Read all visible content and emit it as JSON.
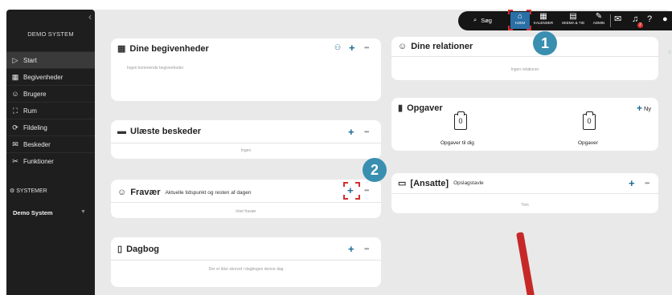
{
  "sidebar": {
    "title": "DEMO SYSTEM",
    "items": [
      {
        "label": "Start",
        "icon": "play-icon",
        "glyph": "▷"
      },
      {
        "label": "Begivenheder",
        "icon": "calendar-icon",
        "glyph": "▦"
      },
      {
        "label": "Brugere",
        "icon": "users-icon",
        "glyph": "☺"
      },
      {
        "label": "Rum",
        "icon": "room-icon",
        "glyph": "⛶"
      },
      {
        "label": "Fildeling",
        "icon": "share-icon",
        "glyph": "⟳"
      },
      {
        "label": "Beskeder",
        "icon": "message-icon",
        "glyph": "✉"
      },
      {
        "label": "Funktioner",
        "icon": "tools-icon",
        "glyph": "✂"
      }
    ],
    "section_label": "SYSTEMER",
    "system_name": "Demo System"
  },
  "topbar": {
    "search_label": "Søg",
    "home_label": "HJEM",
    "calendar_label": "KALENDER",
    "schedule_label": "SKEMA & TID",
    "admin_label": "ADMIN",
    "notification_count": "2"
  },
  "cards": {
    "events": {
      "title": "Dine begivenheder",
      "empty": "Ingen kommende begivenheder"
    },
    "relations": {
      "title": "Dine relationer",
      "empty": "Ingen relationer"
    },
    "messages": {
      "title": "Ulæste beskeder",
      "empty": "Ingen"
    },
    "tasks": {
      "title": "Opgaver",
      "new_label": "Ny",
      "items": [
        {
          "count": "0",
          "label": "Opgaver til dig"
        },
        {
          "count": "0",
          "label": "Opgaver"
        }
      ]
    },
    "absence": {
      "title": "Fravær",
      "subtitle": "Aktuelle tidspunkt og resten af dagen",
      "empty": "Intet fravær"
    },
    "board": {
      "title": "[Ansatte]",
      "subtitle": "Opslagstavle",
      "empty": "Tom"
    },
    "diary": {
      "title": "Dagbog",
      "empty": "Der er ikke skrevet i dagbogen denne dag"
    }
  },
  "callouts": {
    "first": "1",
    "second": "2"
  },
  "colors": {
    "accent": "#1a6c92",
    "sidebar_bg": "#1e1e1e",
    "highlight": "#d32f2f",
    "callout": "#3a8fb0"
  }
}
